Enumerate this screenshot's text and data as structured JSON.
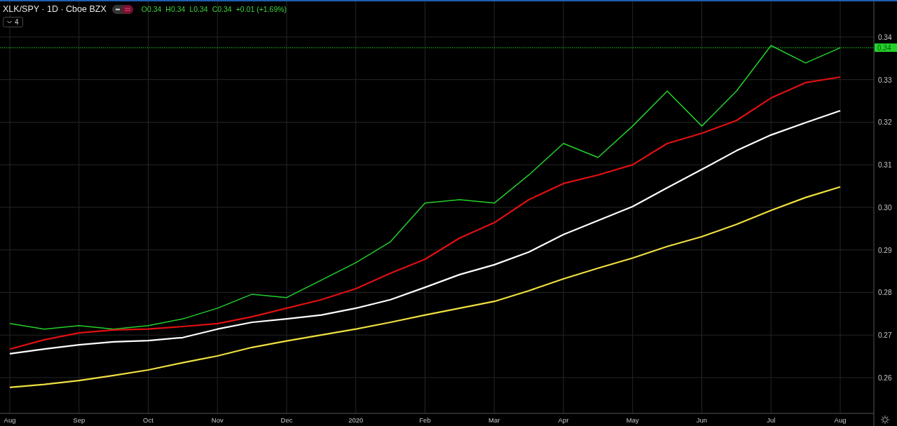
{
  "header": {
    "title": "XLK/SPY · 1D · Cboe BZX",
    "ohlc": [
      "O0.34",
      "H0.34",
      "L0.34",
      "C0.34",
      "+0.01 (+1.69%)"
    ],
    "legend_count": "4"
  },
  "chart": {
    "chart_data": {
      "type": "line",
      "grid": true,
      "ref_lines": [
        {
          "axis": "y",
          "value": 0.3375,
          "color": "#22d22a",
          "label": "0.34"
        }
      ],
      "categories": [
        "Aug",
        null,
        "Sep",
        null,
        "Oct",
        null,
        "Nov",
        null,
        "Dec",
        null,
        "2020",
        null,
        "Feb",
        null,
        "Mar",
        null,
        "Apr",
        null,
        "May",
        null,
        "Jun",
        null,
        "Jul",
        null,
        "Aug"
      ],
      "series": [
        {
          "color": "#22d22a",
          "values": [
            0.2727,
            0.2714,
            0.2722,
            0.2714,
            0.2722,
            0.2738,
            0.2763,
            0.2796,
            0.2788,
            0.2829,
            0.287,
            0.2919,
            0.301,
            0.3018,
            0.301,
            0.3076,
            0.315,
            0.3117,
            0.3191,
            0.3273,
            0.3191,
            0.3273,
            0.338,
            0.3339,
            0.3375
          ]
        },
        {
          "color": "#e01010",
          "values": [
            0.2667,
            0.2689,
            0.2705,
            0.2712,
            0.2714,
            0.272,
            0.2727,
            0.2743,
            0.2763,
            0.2783,
            0.2809,
            0.2845,
            0.2878,
            0.2928,
            0.2964,
            0.3018,
            0.3056,
            0.3076,
            0.31,
            0.315,
            0.3174,
            0.3204,
            0.3257,
            0.3293,
            0.3306
          ]
        },
        {
          "color": "#ffffff",
          "values": [
            0.2656,
            0.2667,
            0.2677,
            0.2684,
            0.2687,
            0.2694,
            0.2714,
            0.273,
            0.2738,
            0.2747,
            0.2763,
            0.2783,
            0.2812,
            0.2842,
            0.2865,
            0.2895,
            0.2936,
            0.2969,
            0.3002,
            0.3046,
            0.3089,
            0.3133,
            0.317,
            0.3199,
            0.3227
          ]
        },
        {
          "color": "#f0e040",
          "values": [
            0.2577,
            0.2584,
            0.2593,
            0.2605,
            0.2618,
            0.2635,
            0.2651,
            0.2671,
            0.2686,
            0.27,
            0.2714,
            0.273,
            0.2747,
            0.2763,
            0.2779,
            0.2804,
            0.2832,
            0.2857,
            0.2881,
            0.2908,
            0.2931,
            0.296,
            0.2993,
            0.3023,
            0.3048
          ]
        }
      ],
      "ylim": [
        0.2516,
        0.3487
      ],
      "yticks": [
        {
          "value": 0.34,
          "label": "0.34"
        },
        {
          "value": 0.33,
          "label": "0.33"
        },
        {
          "value": 0.32,
          "label": "0.32"
        },
        {
          "value": 0.31,
          "label": "0.31"
        },
        {
          "value": 0.3,
          "label": "0.30"
        },
        {
          "value": 0.29,
          "label": "0.29"
        },
        {
          "value": 0.28,
          "label": "0.28"
        },
        {
          "value": 0.27,
          "label": "0.27"
        },
        {
          "value": 0.26,
          "label": "0.26"
        }
      ]
    }
  }
}
